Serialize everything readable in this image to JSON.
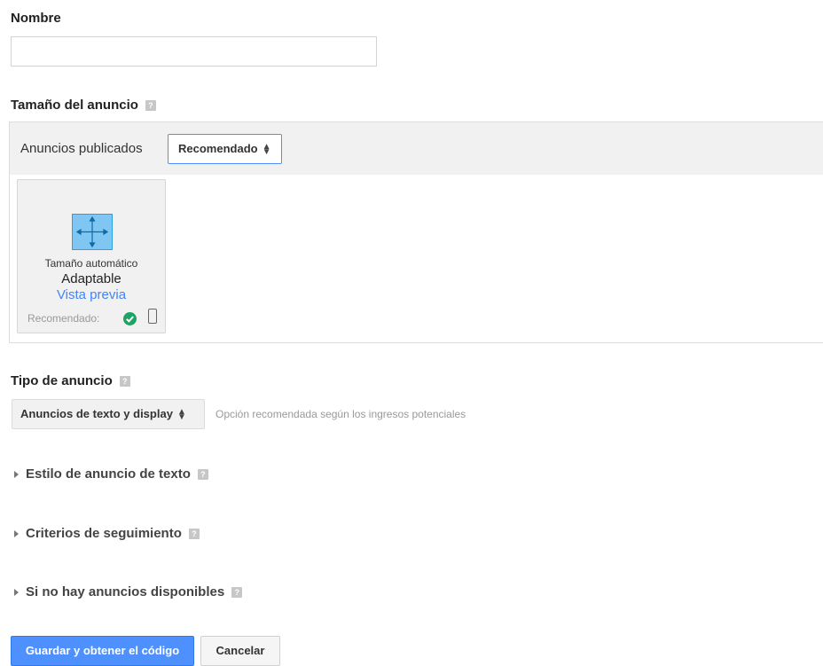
{
  "name_section": {
    "label": "Nombre",
    "input_value": "",
    "placeholder": ""
  },
  "size_section": {
    "label": "Tamaño del anuncio",
    "help": "?",
    "published_label": "Anuncios publicados",
    "filter_select": "Recomendado",
    "card": {
      "line1": "Tamaño automático",
      "line2": "Adaptable",
      "preview_link": "Vista previa",
      "recommended_label": "Recomendado:",
      "icons": [
        "move-arrows-icon",
        "check-circle-icon",
        "mobile-phone-icon"
      ]
    }
  },
  "type_section": {
    "label": "Tipo de anuncio",
    "help": "?",
    "select_value": "Anuncios de texto y display",
    "hint": "Opción recomendada según los ingresos potenciales"
  },
  "collapsibles": [
    {
      "label": "Estilo de anuncio de texto",
      "help": "?"
    },
    {
      "label": "Criterios de seguimiento",
      "help": "?"
    },
    {
      "label": "Si no hay anuncios disponibles",
      "help": "?"
    }
  ],
  "actions": {
    "save": "Guardar y obtener el código",
    "cancel": "Cancelar"
  },
  "colors": {
    "primary": "#4d90fe",
    "link": "#4285f4",
    "success": "#1ea362",
    "panel_bg": "#f1f1f1"
  }
}
